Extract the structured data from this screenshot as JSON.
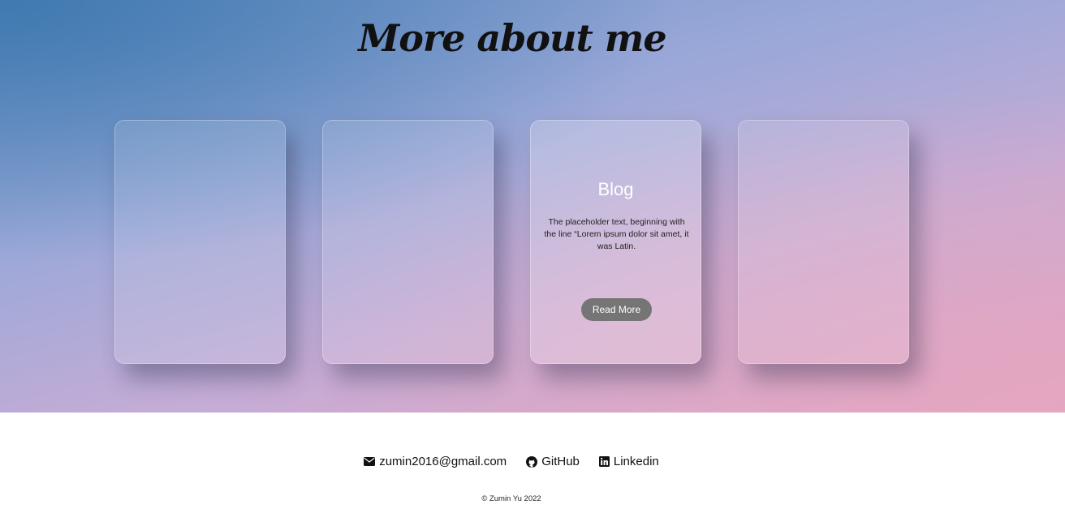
{
  "hero": {
    "title": "More about me"
  },
  "cards": [
    {
      "title": "",
      "text": "",
      "button": ""
    },
    {
      "title": "",
      "text": "",
      "button": ""
    },
    {
      "title": "Blog",
      "text": "The placeholder text, beginning with the line “Lorem ipsum dolor sit amet, it was Latin.",
      "button": "Read More"
    },
    {
      "title": "",
      "text": "",
      "button": ""
    }
  ],
  "footer": {
    "email": {
      "label": "zumin2016@gmail.com",
      "icon": "envelope-icon"
    },
    "github": {
      "label": "GitHub",
      "icon": "github-icon"
    },
    "linkedin": {
      "label": "Linkedin",
      "icon": "linkedin-icon"
    },
    "copyright": "© Zumin Yu 2022"
  }
}
